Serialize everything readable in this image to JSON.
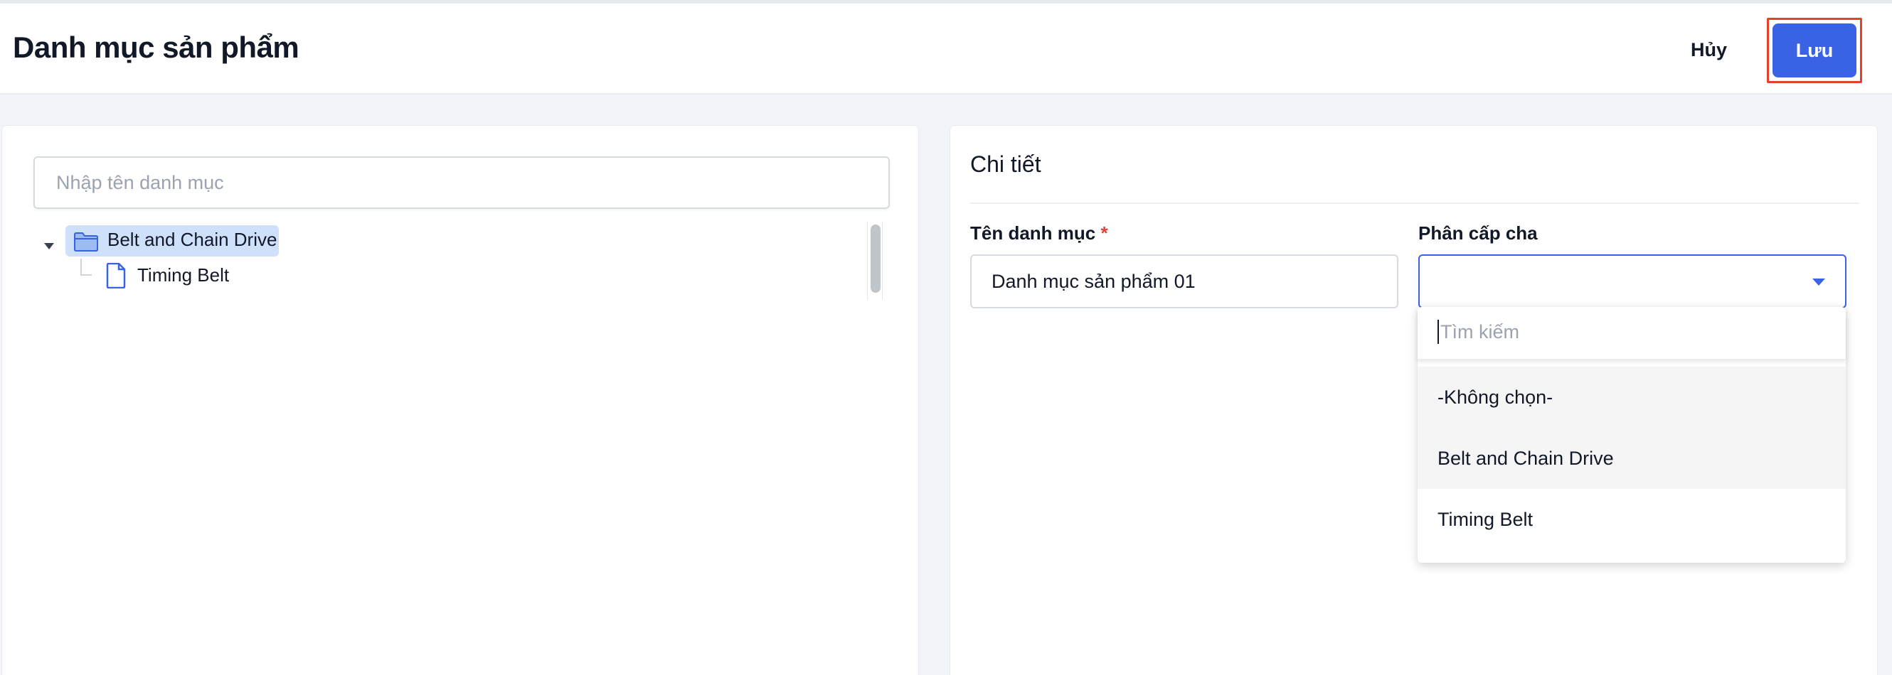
{
  "header": {
    "title": "Danh mục sản phẩm",
    "cancel_label": "Hủy",
    "save_label": "Lưu"
  },
  "tree": {
    "search_placeholder": "Nhập tên danh mục",
    "nodes": [
      {
        "label": "Belt and Chain Drive",
        "type": "folder",
        "expanded": true,
        "selected": true
      },
      {
        "label": "Timing Belt",
        "type": "file",
        "selected": false
      }
    ]
  },
  "detail": {
    "title": "Chi tiết",
    "name_label": "Tên danh mục",
    "required_mark": "*",
    "name_value": "Danh mục sản phẩm 01",
    "parent_label": "Phân cấp cha",
    "parent_value": ""
  },
  "dropdown": {
    "search_placeholder": "Tìm kiếm",
    "options": [
      "-Không chọn-",
      "Belt and Chain Drive",
      "Timing Belt"
    ]
  },
  "colors": {
    "primary": "#3a62e4",
    "highlight_border": "#e2412b",
    "selected_node_bg": "#cfe0fb",
    "required": "#e53e3e"
  }
}
